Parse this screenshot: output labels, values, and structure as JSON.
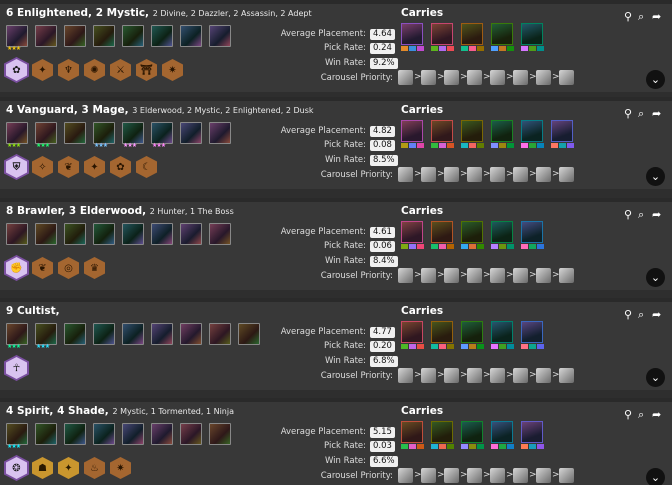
{
  "comps": [
    {
      "title_main": "6 Enlightened, 2 Mystic,",
      "title_sub": "2 Divine, 2 Dazzler, 2 Assassin, 2 Adept",
      "champ_count": 8,
      "stars": [
        "★★★",
        "",
        "",
        "",
        "",
        "",
        "",
        ""
      ],
      "traits": [
        {
          "tier": "prismatic",
          "icon": "enlightened-icon"
        },
        {
          "tier": "bronze",
          "icon": "mystic-icon"
        },
        {
          "tier": "bronze",
          "icon": "divine-icon"
        },
        {
          "tier": "bronze",
          "icon": "dazzler-icon"
        },
        {
          "tier": "bronze",
          "icon": "assassin-icon"
        },
        {
          "tier": "bronze",
          "icon": "adept-icon"
        },
        {
          "tier": "bronze",
          "icon": "ninja-icon"
        }
      ],
      "stats": {
        "avg_label": "Average Placement:",
        "avg": "4.64",
        "pick_label": "Pick Rate:",
        "pick": "0.24",
        "win_label": "Win Rate:",
        "win": "9.2%",
        "carousel_label": "Carousel Priority:"
      },
      "carries_label": "Carries",
      "carry_count": 5,
      "carousel_count": 8
    },
    {
      "title_main": "4 Vanguard, 3 Mage,",
      "title_sub": "3 Elderwood, 2 Mystic, 2 Enlightened, 2 Dusk",
      "champ_count": 8,
      "stars": [
        "★★★",
        "★★★",
        "",
        "★★★",
        "★★★",
        "★★★",
        "",
        ""
      ],
      "traits": [
        {
          "tier": "prismatic",
          "icon": "vanguard-icon"
        },
        {
          "tier": "bronze",
          "icon": "mage-icon"
        },
        {
          "tier": "bronze",
          "icon": "elderwood-icon"
        },
        {
          "tier": "bronze",
          "icon": "mystic-icon"
        },
        {
          "tier": "bronze",
          "icon": "enlightened-icon"
        },
        {
          "tier": "bronze",
          "icon": "dusk-icon"
        }
      ],
      "stats": {
        "avg_label": "Average Placement:",
        "avg": "4.82",
        "pick_label": "Pick Rate:",
        "pick": "0.08",
        "win_label": "Win Rate:",
        "win": "8.5%",
        "carousel_label": "Carousel Priority:"
      },
      "carries_label": "Carries",
      "carry_count": 6,
      "carousel_count": 8
    },
    {
      "title_main": "8 Brawler, 3 Elderwood,",
      "title_sub": "2 Hunter, 1 The Boss",
      "champ_count": 8,
      "stars": [
        "",
        "",
        "",
        "",
        "",
        "",
        "",
        ""
      ],
      "traits": [
        {
          "tier": "prismatic",
          "icon": "brawler-icon"
        },
        {
          "tier": "bronze",
          "icon": "elderwood-icon"
        },
        {
          "tier": "bronze",
          "icon": "hunter-icon"
        },
        {
          "tier": "bronze",
          "icon": "boss-icon"
        }
      ],
      "stats": {
        "avg_label": "Average Placement:",
        "avg": "4.61",
        "pick_label": "Pick Rate:",
        "pick": "0.06",
        "win_label": "Win Rate:",
        "win": "8.4%",
        "carousel_label": "Carousel Priority:"
      },
      "carries_label": "Carries",
      "carry_count": 5,
      "carousel_count": 8
    },
    {
      "title_main": "9 Cultist,",
      "title_sub": "",
      "champ_count": 9,
      "stars": [
        "★★★",
        "★★★",
        "",
        "",
        "",
        "",
        "",
        "",
        ""
      ],
      "traits": [
        {
          "tier": "prismatic",
          "icon": "cultist-icon"
        }
      ],
      "stats": {
        "avg_label": "Average Placement:",
        "avg": "4.77",
        "pick_label": "Pick Rate:",
        "pick": "0.20",
        "win_label": "Win Rate:",
        "win": "6.8%",
        "carousel_label": "Carousel Priority:"
      },
      "carries_label": "Carries",
      "carry_count": 5,
      "carousel_count": 8
    },
    {
      "title_main": "4 Spirit, 4 Shade,",
      "title_sub": "2 Mystic, 1 Tormented, 1 Ninja",
      "champ_count": 8,
      "stars": [
        "★★★",
        "",
        "",
        "",
        "",
        "",
        "",
        ""
      ],
      "traits": [
        {
          "tier": "prismatic",
          "icon": "spirit-icon"
        },
        {
          "tier": "gold",
          "icon": "shade-icon"
        },
        {
          "tier": "gold",
          "icon": "mystic-icon"
        },
        {
          "tier": "bronze",
          "icon": "tormented-icon"
        },
        {
          "tier": "bronze",
          "icon": "ninja-icon"
        }
      ],
      "stats": {
        "avg_label": "Average Placement:",
        "avg": "5.15",
        "pick_label": "Pick Rate:",
        "pick": "0.03",
        "win_label": "Win Rate:",
        "win": "6.6%",
        "carousel_label": "Carousel Priority:"
      },
      "carries_label": "Carries",
      "carry_count": 5,
      "carousel_count": 8
    }
  ],
  "ui": {
    "pin_icon": "pin-icon",
    "search_icon": "search-icon",
    "share_icon": "share-icon",
    "expand_icon": "chevron-down-icon",
    "arrow": ">"
  }
}
